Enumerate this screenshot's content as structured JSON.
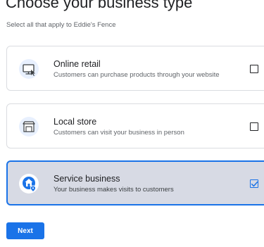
{
  "header": {
    "title": "Choose your business type",
    "subtitle": "Select all that apply to Eddie's Fence"
  },
  "options": [
    {
      "title": "Online retail",
      "description": "Customers can purchase products through your website",
      "icon": "online-retail-icon",
      "checked": false
    },
    {
      "title": "Local store",
      "description": "Customers can visit your business in person",
      "icon": "storefront-icon",
      "checked": false
    },
    {
      "title": "Service business",
      "description": "Your business makes visits to customers",
      "icon": "home-pin-icon",
      "checked": true
    }
  ],
  "footer": {
    "next_label": "Next"
  },
  "colors": {
    "accent": "#1a73e8",
    "selected_background": "#d7dae4",
    "icon_circle": "#e8f0fe"
  }
}
